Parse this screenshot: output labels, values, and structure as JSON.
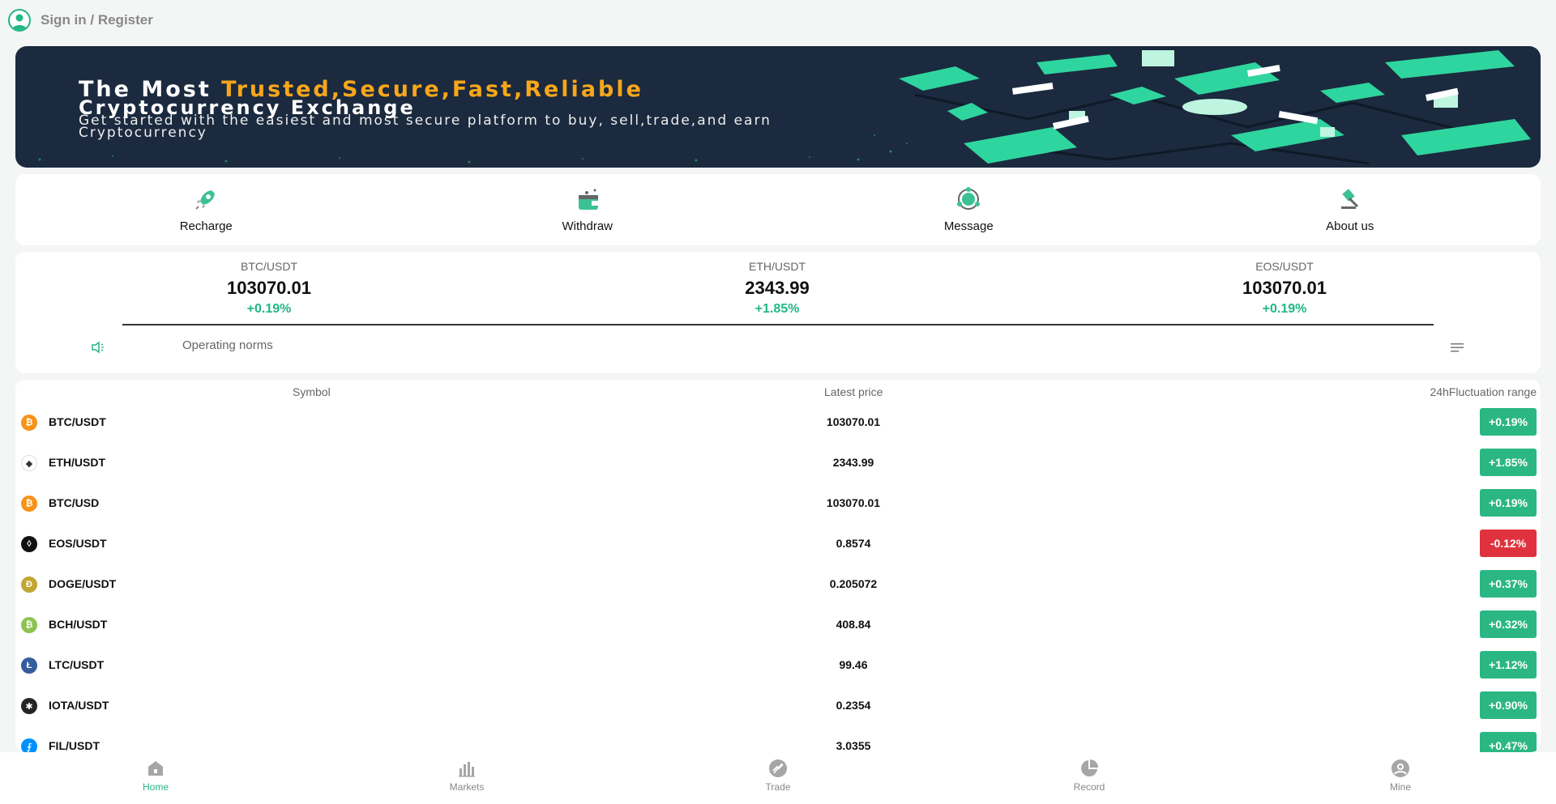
{
  "header": {
    "signin_label": "Sign in / Register"
  },
  "banner": {
    "line1_prefix": "The Most ",
    "line1_highlight": "Trusted,Secure,Fast,Reliable",
    "line2": "Cryptocurrency Exchange",
    "line3": "Get started with the easiest and most secure platform to buy, sell,trade,and earn Cryptocurrency"
  },
  "actions": [
    {
      "label": "Recharge",
      "icon": "rocket-icon"
    },
    {
      "label": "Withdraw",
      "icon": "wallet-icon"
    },
    {
      "label": "Message",
      "icon": "message-icon"
    },
    {
      "label": "About us",
      "icon": "gavel-icon"
    }
  ],
  "tickers": [
    {
      "pair": "BTC/USDT",
      "price": "103070.01",
      "change": "+0.19%"
    },
    {
      "pair": "ETH/USDT",
      "price": "2343.99",
      "change": "+1.85%"
    },
    {
      "pair": "EOS/USDT",
      "price": "103070.01",
      "change": "+0.19%"
    }
  ],
  "notice": {
    "text": "Operating norms",
    "icon": "speaker-icon",
    "menu_icon": "menu-lines-icon"
  },
  "market": {
    "headers": {
      "symbol": "Symbol",
      "price": "Latest price",
      "range": "24hFluctuation range"
    },
    "rows": [
      {
        "symbol": "BTC/USDT",
        "price": "103070.01",
        "change": "+0.19%",
        "up": true,
        "coin_color": "#f7931a",
        "glyph": "₿"
      },
      {
        "symbol": "ETH/USDT",
        "price": "2343.99",
        "change": "+1.85%",
        "up": true,
        "coin_color": "#ffffff",
        "glyph": "◆"
      },
      {
        "symbol": "BTC/USD",
        "price": "103070.01",
        "change": "+0.19%",
        "up": true,
        "coin_color": "#f7931a",
        "glyph": "₿"
      },
      {
        "symbol": "EOS/USDT",
        "price": "0.8574",
        "change": "-0.12%",
        "up": false,
        "coin_color": "#111111",
        "glyph": "◊"
      },
      {
        "symbol": "DOGE/USDT",
        "price": "0.205072",
        "change": "+0.37%",
        "up": true,
        "coin_color": "#c2a633",
        "glyph": "Ð"
      },
      {
        "symbol": "BCH/USDT",
        "price": "408.84",
        "change": "+0.32%",
        "up": true,
        "coin_color": "#8dc351",
        "glyph": "₿"
      },
      {
        "symbol": "LTC/USDT",
        "price": "99.46",
        "change": "+1.12%",
        "up": true,
        "coin_color": "#345d9d",
        "glyph": "Ł"
      },
      {
        "symbol": "IOTA/USDT",
        "price": "0.2354",
        "change": "+0.90%",
        "up": true,
        "coin_color": "#242424",
        "glyph": "✱"
      },
      {
        "symbol": "FIL/USDT",
        "price": "3.0355",
        "change": "+0.47%",
        "up": true,
        "coin_color": "#0090ff",
        "glyph": "⨍"
      }
    ]
  },
  "colors": {
    "accent": "#22b784",
    "up": "#2bb783",
    "down": "#e0323e"
  },
  "tabbar": [
    {
      "label": "Home",
      "icon": "home-icon",
      "active": true
    },
    {
      "label": "Markets",
      "icon": "bar-chart-icon",
      "active": false
    },
    {
      "label": "Trade",
      "icon": "trade-icon",
      "active": false
    },
    {
      "label": "Record",
      "icon": "pie-chart-icon",
      "active": false
    },
    {
      "label": "Mine",
      "icon": "user-icon",
      "active": false
    }
  ]
}
